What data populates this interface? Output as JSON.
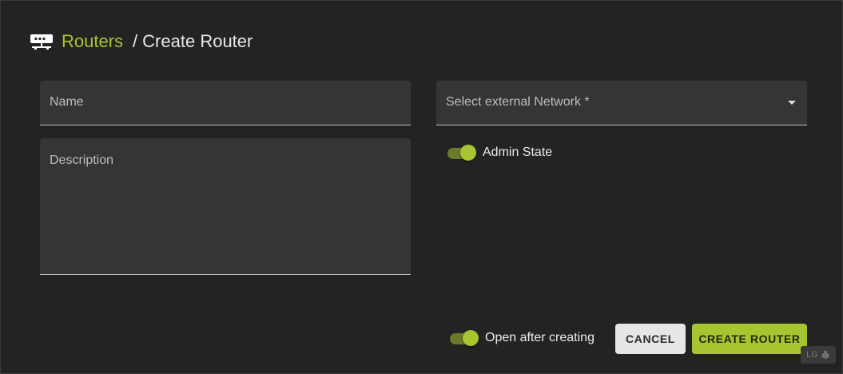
{
  "breadcrumb": {
    "section": "Routers",
    "separator": "/",
    "current": "Create Router"
  },
  "form": {
    "name_label": "Name",
    "description_label": "Description",
    "network_label": "Select external Network *",
    "admin_state_label": "Admin State",
    "admin_state_on": true,
    "open_after_label": "Open after creating",
    "open_after_on": true
  },
  "actions": {
    "cancel_label": "CANCEL",
    "create_label": "CREATE ROUTER"
  },
  "debug_badge": {
    "label": "LG"
  },
  "colors": {
    "accent": "#a6c531",
    "background": "#232323",
    "field": "#353535"
  }
}
